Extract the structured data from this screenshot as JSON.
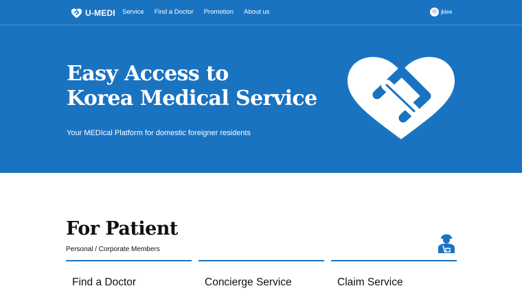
{
  "brand": {
    "logo_icon": "heart-logo-icon",
    "name": "U-MEDI",
    "accent_color": "#1a73c1"
  },
  "nav": {
    "links": [
      "Service",
      "Find a Doctor",
      "Promotion",
      "About us"
    ]
  },
  "user": {
    "avatar_icon": "user-avatar-icon",
    "name": "jklee"
  },
  "hero": {
    "title_line1": "Easy Access to",
    "title_line2": "Korea Medical Service",
    "subtitle": "Your MEDIcal Platform for domestic foreigner residents",
    "logo_icon": "heart-link-logo-icon"
  },
  "patient_section": {
    "title": "For Patient",
    "subtitle": "Personal / Corporate  Members",
    "icon": "patient-icon",
    "cards": [
      "Find a Doctor",
      "Concierge Service",
      "Claim Service"
    ]
  }
}
